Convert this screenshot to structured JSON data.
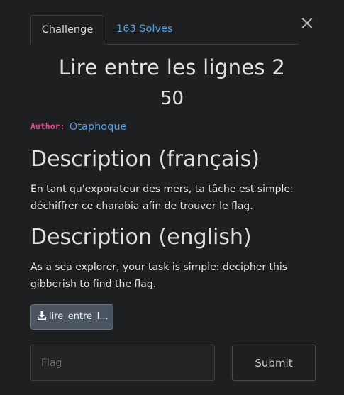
{
  "tabs": {
    "challenge": "Challenge",
    "solves": "163 Solves"
  },
  "challenge": {
    "title": "Lire entre les lignes 2",
    "points": "50",
    "author_label": "Author:",
    "author_name": "Otaphoque"
  },
  "description_fr": {
    "heading": "Description (français)",
    "text": "En tant qu'exporateur des mers, ta tâche est simple: déchiffrer ce charabia afin de trouver le flag."
  },
  "description_en": {
    "heading": "Description (english)",
    "text": "As a sea explorer, your task is simple: decipher this gibberish to find the flag."
  },
  "file": {
    "label": "lire_entre_l..."
  },
  "form": {
    "flag_placeholder": "Flag",
    "submit_label": "Submit"
  },
  "icons": {
    "close": "close-icon",
    "download": "download-icon"
  },
  "colors": {
    "background": "#1e1f20",
    "link": "#4e9ee8",
    "author_label": "#e83e8c",
    "file_button": "#4c5562"
  }
}
